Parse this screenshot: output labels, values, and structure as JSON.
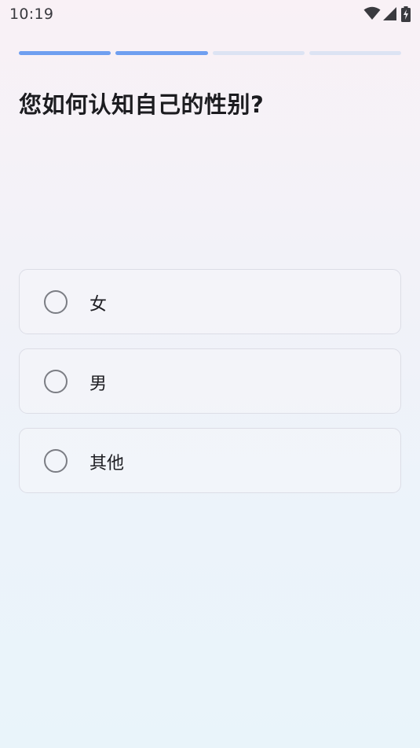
{
  "status_bar": {
    "time": "10:19",
    "icons": [
      "wifi-icon",
      "cell-signal-icon",
      "battery-charging-icon"
    ]
  },
  "progress": {
    "total_steps": 4,
    "completed_steps": 2,
    "active_color": "#6f9ff0",
    "inactive_color": "#dce3f3"
  },
  "question": {
    "title": "您如何认知自己的性别?"
  },
  "options": [
    {
      "label": "女",
      "selected": false
    },
    {
      "label": "男",
      "selected": false
    },
    {
      "label": "其他",
      "selected": false
    }
  ]
}
